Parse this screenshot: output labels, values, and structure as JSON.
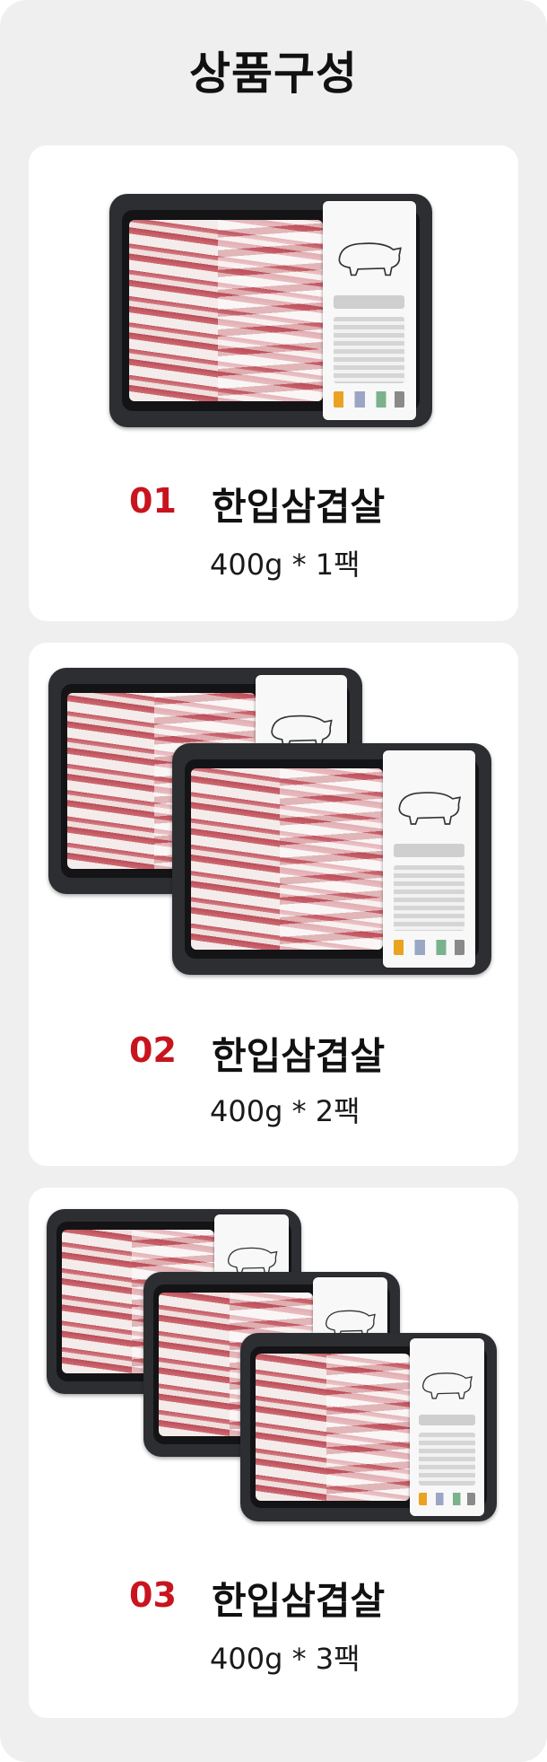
{
  "page_title": "상품구성",
  "products": [
    {
      "number": "01",
      "name": "한입삼겹살",
      "quantity": "400g * 1팩",
      "pack_count": 1
    },
    {
      "number": "02",
      "name": "한입삼겹살",
      "quantity": "400g * 2팩",
      "pack_count": 2
    },
    {
      "number": "03",
      "name": "한입삼겹살",
      "quantity": "400g * 3팩",
      "pack_count": 3
    }
  ],
  "colors": {
    "accent": "#c8141e",
    "background": "#efefef",
    "card": "#ffffff",
    "tray": "#2d2e31"
  },
  "icons": {
    "pack_image": "pork-belly-pack-icon",
    "label_animal": "pig-icon"
  }
}
